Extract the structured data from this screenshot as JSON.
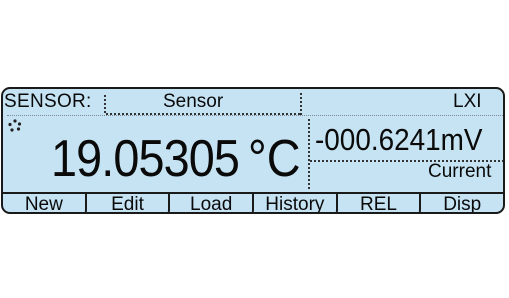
{
  "header": {
    "mode_label": "SENSOR:",
    "sensor_label": "Sensor",
    "lxi_label": "LXI"
  },
  "icons": {
    "trigger": "trigger-indicator-icon"
  },
  "primary": {
    "value": "19.05305",
    "unit": "°C"
  },
  "secondary": {
    "value": "-000.6241mV",
    "label": "Current"
  },
  "softkeys": [
    {
      "label": "New"
    },
    {
      "label": "Edit"
    },
    {
      "label": "Load"
    },
    {
      "label": "History"
    },
    {
      "label": "REL"
    },
    {
      "label": "Disp"
    }
  ],
  "colors": {
    "lcd_background": "#c6e3f3",
    "text": "#0a0a0a",
    "frame": "#1a1a1a"
  }
}
